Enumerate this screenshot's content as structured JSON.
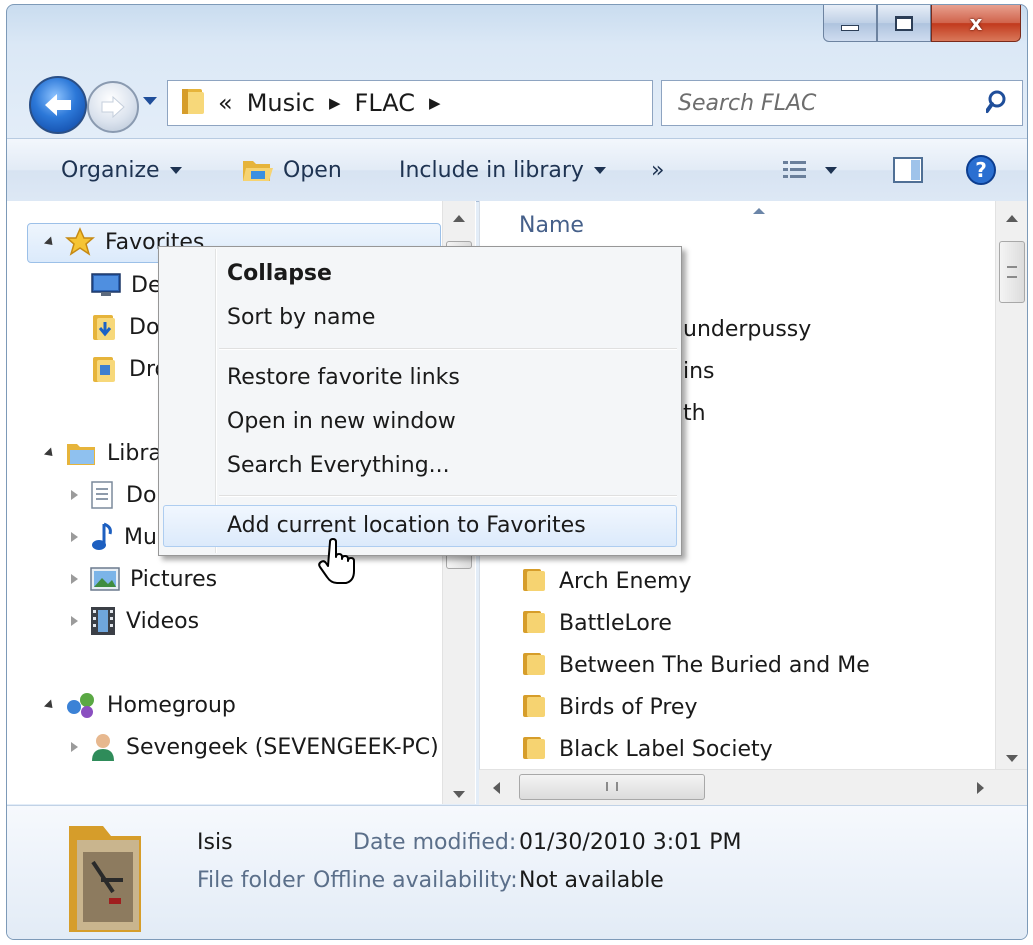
{
  "window": {
    "caption_buttons": [
      "minimize",
      "maximize",
      "close"
    ],
    "close_glyph": "x"
  },
  "nav": {
    "address_prefix": "«",
    "breadcrumbs": [
      "Music",
      "FLAC"
    ],
    "search_placeholder": "Search FLAC"
  },
  "toolbar": {
    "organize": "Organize",
    "open": "Open",
    "include_in_library": "Include in library",
    "overflow": "»"
  },
  "tree": {
    "favorites": {
      "label": "Favorites",
      "items": [
        "De",
        "Do",
        "Dro"
      ]
    },
    "libraries": {
      "label": "Libra",
      "items": [
        "Do",
        "Mu",
        "Pictures",
        "Videos"
      ]
    },
    "homegroup": {
      "label": "Homegroup",
      "items": [
        "Sevengeek (SEVENGEEK-PC)"
      ]
    }
  },
  "file_list": {
    "column_header": "Name",
    "partial_rows": [
      "underpussy",
      "ins",
      "th"
    ],
    "folders": [
      "Arch Enemy",
      "BattleLore",
      "Between The Buried and Me",
      "Birds of Prey",
      "Black Label Society"
    ]
  },
  "context_menu": {
    "items": [
      {
        "label": "Collapse",
        "bold": true
      },
      {
        "label": "Sort by name"
      },
      {
        "label": "Restore favorite links"
      },
      {
        "label": "Open in new window"
      },
      {
        "label": "Search Everything..."
      },
      {
        "label": "Add current location to Favorites",
        "highlighted": true
      }
    ]
  },
  "details": {
    "name": "Isis",
    "type": "File folder",
    "date_modified_label": "Date modified:",
    "date_modified_value": "01/30/2010 3:01 PM",
    "offline_label": "Offline availability:",
    "offline_value": "Not available"
  },
  "colors": {
    "folder": "#e6b43b",
    "accent_blue": "#1d62c6",
    "close_red": "#c1391c"
  }
}
